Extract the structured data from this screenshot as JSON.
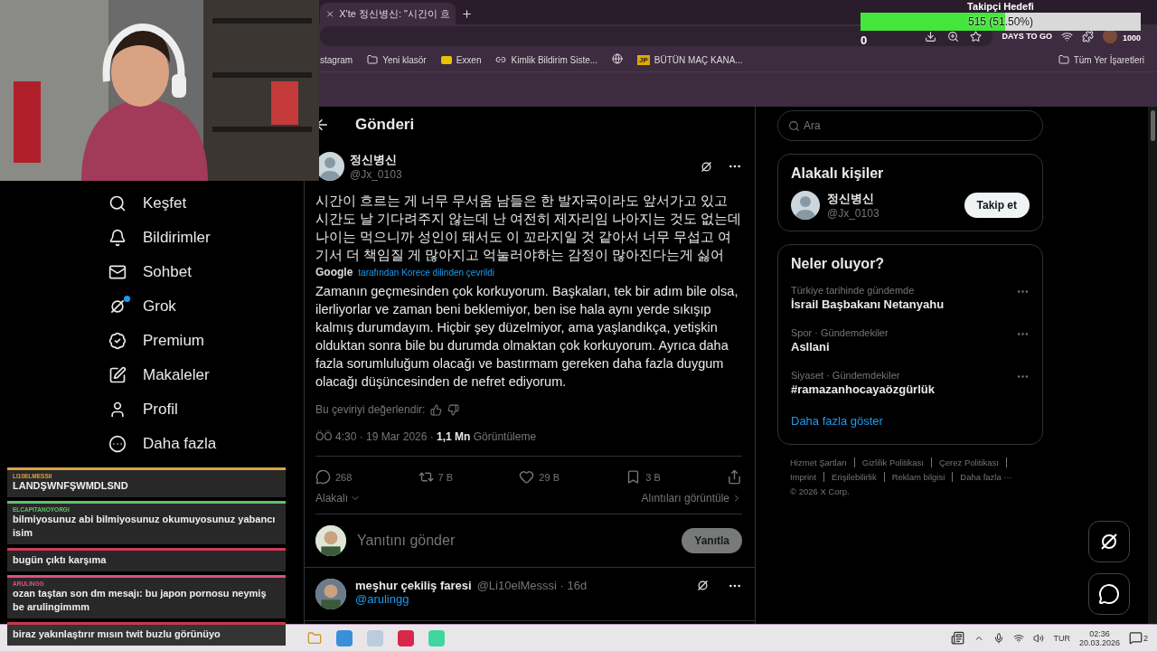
{
  "browser": {
    "tab": {
      "title": "X'te 정신병신: \"시간이 흐",
      "selected": true
    },
    "bookmarks": [
      {
        "kind": "text",
        "label": "stagram"
      },
      {
        "kind": "folder",
        "label": "Yeni klasör"
      },
      {
        "kind": "yellow",
        "label": "Exxen"
      },
      {
        "kind": "link",
        "label": "Kimlik Bildirim Siste..."
      },
      {
        "kind": "globe"
      },
      {
        "kind": "jp",
        "badge": "JP",
        "label": "BÜTÜN MAÇ KANA..."
      }
    ],
    "all_bookmarks": "Tüm Yer İşaretleri",
    "extension_text": "DAYS TO GO"
  },
  "follower_goal": {
    "title": "Takipçi Hedefi",
    "reading": "515 (51.50%)",
    "level": 0.515,
    "min": "0",
    "max": "1000"
  },
  "nav": [
    {
      "label": "Keşfet",
      "kind": "search",
      "dot": false
    },
    {
      "label": "Bildirimler",
      "kind": "bell",
      "dot": false
    },
    {
      "label": "Sohbet",
      "kind": "mail",
      "dot": false
    },
    {
      "label": "Grok",
      "kind": "grok",
      "dot": true
    },
    {
      "label": "Premium",
      "kind": "badge",
      "dot": false
    },
    {
      "label": "Makaleler",
      "kind": "article",
      "dot": false
    },
    {
      "label": "Profil",
      "kind": "user",
      "dot": false
    },
    {
      "label": "Daha fazla",
      "kind": "more",
      "dot": false
    }
  ],
  "chat": [
    {
      "user": "LI10ELMESSII",
      "color": "#d9a441",
      "message": "LANDŞWNFŞWMDLSND"
    },
    {
      "user": "ELCAPITANOYORGI",
      "color": "#5ec46a",
      "message": "bilmiyosunuz abi bilmiyosunuz okumuyosunuz yabancı isim"
    },
    {
      "color": "#d13a5a",
      "message": "bugün çıktı karşıma"
    },
    {
      "user": "ARULINGG",
      "color": "#e0507a",
      "message": "ozan taştan son dm mesajı: bu japon pornosu neymiş be arulingimmm"
    },
    {
      "color": "#c8384e",
      "message": "biraz yakınlaştırır mısın twit buzlu görünüyo"
    }
  ],
  "header": {
    "title": "Gönderi"
  },
  "tweet": {
    "name": "정신병신",
    "handle": "@Jx_0103",
    "text": "시간이 흐르는 게 너무 무서움  남들은 한 발자국이라도 앞서가고 있고 시간도 날 기다려주지 않는데 난 여전히 제자리임 나아지는 것도 없는데 나이는 먹으니까 성인이 돼서도 이 꼬라지일 것 같아서 너무 무섭고 여기서 더 책임질 게 많아지고 억눌러야하는 감정이 많아진다는게 싫어",
    "translator": "Google",
    "translated_note": "tarafından Korece dilinden çevrildi",
    "translation": "Zamanın geçmesinden çok korkuyorum. Başkaları, tek bir adım bile olsa, ilerliyorlar ve zaman beni beklemiyor, ben ise hala aynı yerde sıkışıp kalmış durumdayım. Hiçbir şey düzelmiyor, ama yaşlandıkça, yetişkin olduktan sonra bile bu durumda olmaktan çok korkuyorum. Ayrıca daha fazla sorumluluğum olacağı ve bastırmam gereken daha fazla duygum olacağı düşüncesinden de nefret ediyorum.",
    "rate_label": "Bu çeviriyi değerlendir:",
    "meta": "ÖÖ 4:30 · 19 Mar 2026 · **1,1 Mn** Görüntüleme",
    "actions": [
      {
        "kind": "reply",
        "count": "268"
      },
      {
        "kind": "repost",
        "count": "7 B"
      },
      {
        "kind": "like",
        "count": "29 B"
      },
      {
        "kind": "bookmark",
        "count": "3 B"
      },
      {
        "kind": "share"
      }
    ],
    "sort": "Alakalı",
    "quotes": "Alıntıları görüntüle"
  },
  "reply_box": {
    "placeholder": "Yanıtını gönder",
    "button": "Yanıtla",
    "disabled": true
  },
  "reply": {
    "name": "meşhur çekiliş faresi",
    "handle": "@Li10elMesssi · 16d",
    "text": "@arulingg"
  },
  "search": {
    "placeholder": "Ara"
  },
  "people": {
    "title": "Alakalı kişiler",
    "name": "정신병신",
    "handle": "@Jx_0103",
    "button": "Takip et"
  },
  "trends": {
    "title": "Neler oluyor?",
    "items": [
      {
        "context": "Türkiye tarihinde gündemde",
        "topic": "İsrail Başbakanı Netanyahu"
      },
      {
        "context": "Spor · Gündemdekiler",
        "topic": "Asllani"
      },
      {
        "context": "Siyaset · Gündemdekiler",
        "topic": "#ramazanhocayaözgürlük"
      }
    ],
    "more": "Daha fazla göster"
  },
  "footer": {
    "links": [
      "Hizmet Şartları",
      "Gizlilik Politikası",
      "Çerez Politikası",
      "Imprint",
      "Erişilebilirlik",
      "Reklam bilgisi",
      "Daha fazla ···"
    ],
    "copyright": "© 2026 X Corp."
  },
  "taskbar": {
    "language": "TUR",
    "time": "02:36",
    "date": "20.03.2026",
    "notifications": "2"
  }
}
